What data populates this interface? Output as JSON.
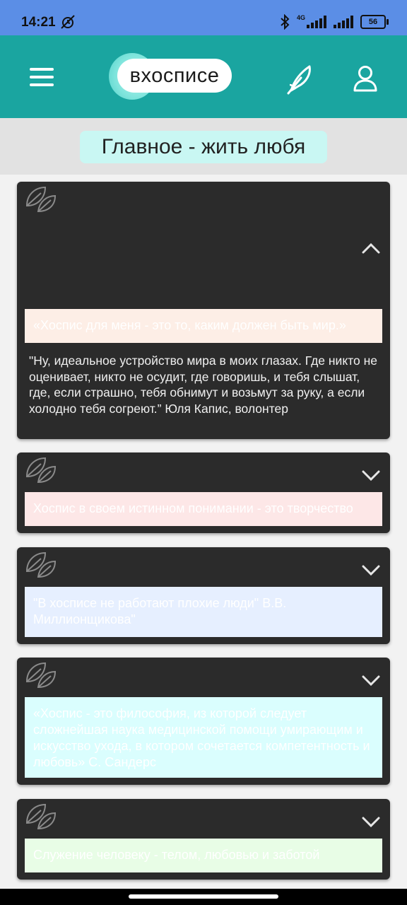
{
  "status_bar": {
    "time": "14:21",
    "network": "4G",
    "battery": "56",
    "icons": [
      "mute-alarm-icon",
      "bluetooth-icon",
      "signal-icon",
      "signal-icon",
      "battery-icon"
    ]
  },
  "header": {
    "logo_text": "вхосписе",
    "icons": [
      "menu-icon",
      "feather-icon",
      "user-icon"
    ],
    "brand_color": "#1aa5a0"
  },
  "page": {
    "title": "Главное - жить любя"
  },
  "cards": [
    {
      "quote": "«Хоспис для меня - это то, каким должен быть мир.»",
      "expanded": true,
      "body": "\"Ну, идеальное устройство мира в моих глазах. Где никто не оценивает, никто не осудит, где говоришь, и тебя слышат, где, если страшно, тебя обнимут и возьмут за руку, а если холодно тебя согреют.” Юля Капис, волонтер",
      "banner_color": "#fdeee6"
    },
    {
      "quote": "Хоспис в своем истинном понимании - это творчество",
      "expanded": false,
      "banner_color": "#fde7e7"
    },
    {
      "quote": "\"В хосписе не работают плохие люди\" В.В. Миллионщикова\"",
      "expanded": false,
      "banner_color": "#e6efff"
    },
    {
      "quote": "«Хоспис - это философия, из которой следует сложнейшая наука медицинской помощи умирающим и искусство ухода, в котором сочетается компетентность и любовь» С. Сандерс",
      "expanded": false,
      "banner_color": "#dafefe"
    },
    {
      "quote": "Служение человеку - телом, любовью и заботой",
      "expanded": false,
      "banner_color": "#e8fde6"
    }
  ]
}
